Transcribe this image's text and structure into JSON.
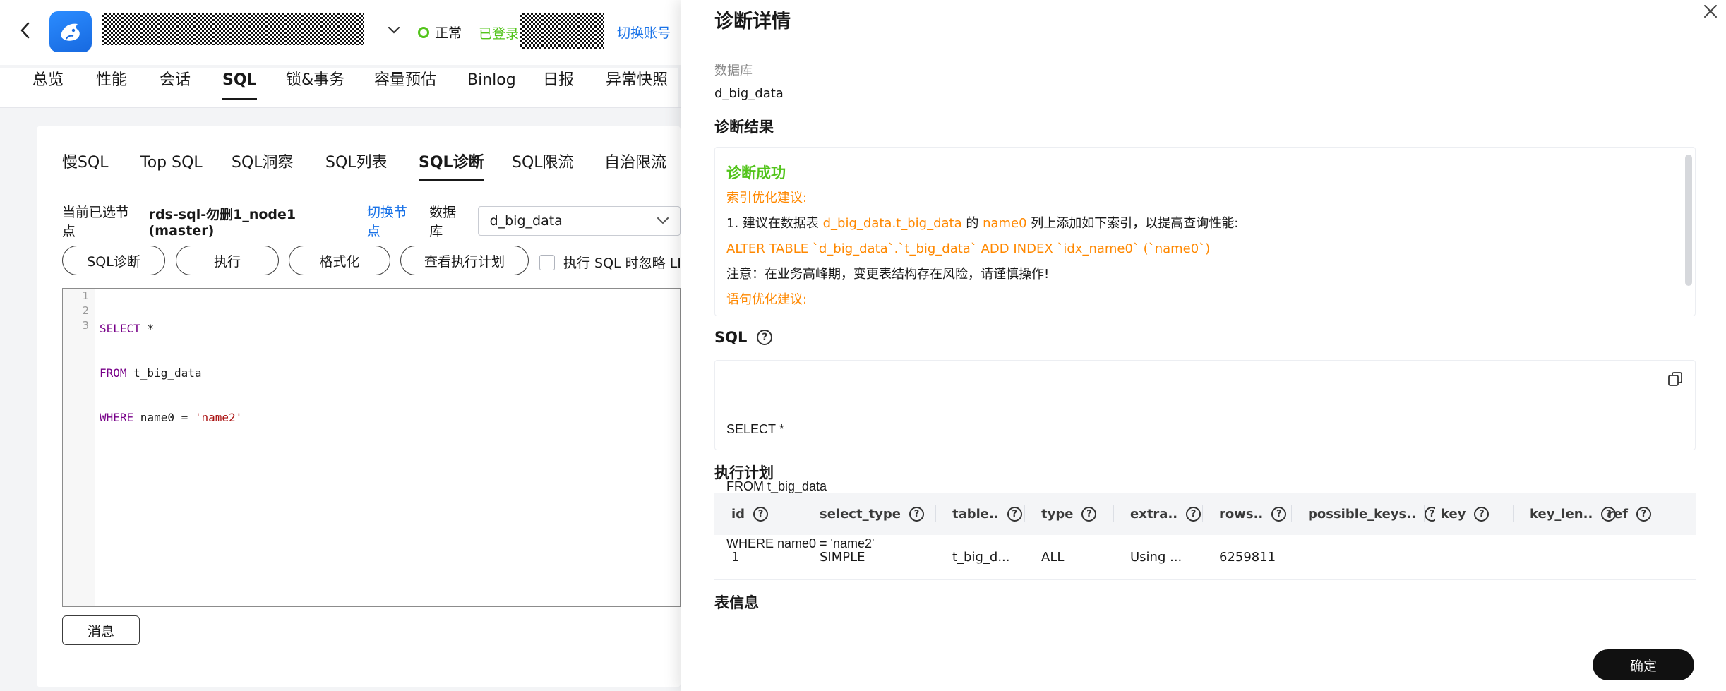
{
  "header": {
    "status_text": "正常",
    "logged_in": "已登录",
    "switch_account": "切换账号",
    "status_color": "#52c41a",
    "link_color": "#1a73e8"
  },
  "main_tabs": [
    "总览",
    "性能",
    "会话",
    "SQL",
    "锁&事务",
    "容量预估",
    "Binlog",
    "日报",
    "异常快照"
  ],
  "main_tab_active": "SQL",
  "sub_tabs": [
    "慢SQL",
    "Top SQL",
    "SQL洞察",
    "SQL列表",
    "SQL诊断",
    "SQL限流",
    "自治限流"
  ],
  "sub_tab_active": "SQL诊断",
  "node_row": {
    "label": "当前已选节点",
    "node": "rds-sql-勿删1_node1 (master)",
    "switch_node": "切换节点",
    "db_label": "数据库",
    "db_value": "d_big_data"
  },
  "buttons": {
    "diagnose": "SQL诊断",
    "execute": "执行",
    "format": "格式化",
    "explain": "查看执行计划",
    "ignore_limit": "执行 SQL 时忽略 LIMIT",
    "message": "消息"
  },
  "editor": {
    "line_numbers": [
      "1",
      "2",
      "3"
    ],
    "line1_kw": "SELECT",
    "line1_rest": " *",
    "line2_kw": "FROM",
    "line2_rest": " t_big_data",
    "line3_kw": "WHERE",
    "line3_rest": " name0 = ",
    "line3_str": "'name2'"
  },
  "drawer": {
    "title": "诊断详情",
    "db_label": "数据库",
    "db_value": "d_big_data",
    "result_title": "诊断结果",
    "result": {
      "status": "诊断成功",
      "index_advice_label": "索引优化建议:",
      "advice_prefix": "1. 建议在数据表 ",
      "advice_table": "d_big_data.t_big_data",
      "advice_mid": " 的 ",
      "advice_column": "name0",
      "advice_suffix": " 列上添加如下索引，以提高查询性能:",
      "ddl": "ALTER TABLE `d_big_data`.`t_big_data` ADD INDEX `idx_name0` (`name0`)",
      "warning": "注意：在业务高峰期，变更表结构存在风险，请谨慎操作!",
      "stmt_advice_label": "语句优化建议:"
    },
    "sql_title": "SQL",
    "sql_lines": [
      "SELECT *",
      "FROM t_big_data",
      "WHERE name0 = 'name2'"
    ],
    "plan_title": "执行计划",
    "plan_columns": [
      "id",
      "select_type",
      "table..",
      "type",
      "extra..",
      "rows..",
      "possible_keys..",
      "key",
      "key_len..",
      "ref"
    ],
    "plan_rows": [
      [
        "1",
        "SIMPLE",
        "t_big_d...",
        "ALL",
        "Using ...",
        "6259811",
        "",
        "",
        "",
        ""
      ]
    ],
    "table_info_title": "表信息",
    "confirm": "确定"
  }
}
